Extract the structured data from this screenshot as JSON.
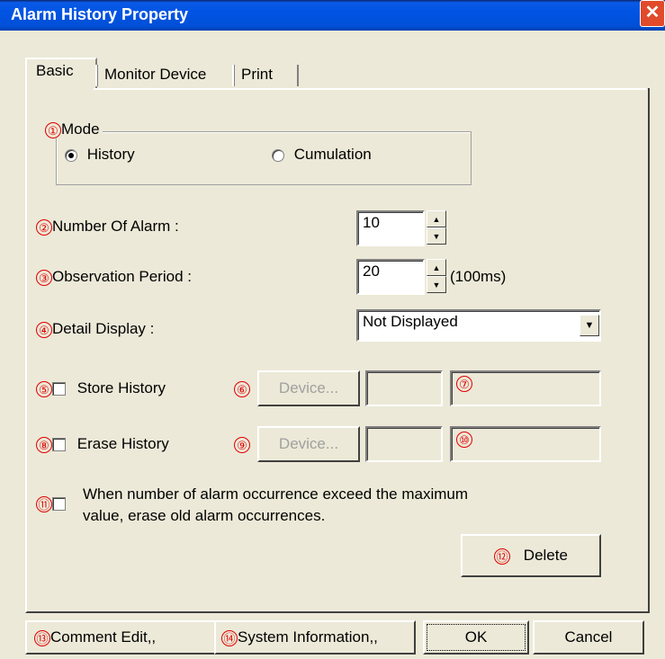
{
  "window": {
    "title": "Alarm History Property",
    "close_glyph": "✕"
  },
  "tabs": [
    {
      "label": "Basic"
    },
    {
      "label": "Monitor Device"
    },
    {
      "label": "Print"
    }
  ],
  "markers": [
    "①",
    "②",
    "③",
    "④",
    "⑤",
    "⑥",
    "⑦",
    "⑧",
    "⑨",
    "⑩",
    "⑪",
    "⑫",
    "⑬",
    "⑭"
  ],
  "mode": {
    "label": "Mode",
    "options": [
      {
        "label": "History",
        "selected": true
      },
      {
        "label": "Cumulation",
        "selected": false
      }
    ]
  },
  "number_of_alarm": {
    "label": "Number Of Alarm :",
    "value": "10"
  },
  "observation_period": {
    "label": "Observation Period :",
    "value": "20",
    "unit": "(100ms)"
  },
  "detail_display": {
    "label": "Detail Display :",
    "value": "Not Displayed"
  },
  "store_history": {
    "label": "Store History",
    "checked": false,
    "device_button": "Device...",
    "device_value": "",
    "info_value": ""
  },
  "erase_history": {
    "label": "Erase History",
    "checked": false,
    "device_button": "Device...",
    "device_value": "",
    "info_value": ""
  },
  "erase_old": {
    "label_line1": "When number of alarm occurrence exceed the maximum",
    "label_line2": "value, erase old alarm occurrences.",
    "checked": false
  },
  "delete_button": "Delete",
  "footer": {
    "comment_edit": "Comment Edit,,",
    "system_information": "System Information,,",
    "ok": "OK",
    "cancel": "Cancel"
  },
  "icons": {
    "spin_up": "▲",
    "spin_down": "▼",
    "dropdown": "▼"
  },
  "colors": {
    "titlebar": "#0054e3",
    "dialog_bg": "#ece9d8",
    "marker": "#e00000",
    "close": "#e14a2a"
  }
}
